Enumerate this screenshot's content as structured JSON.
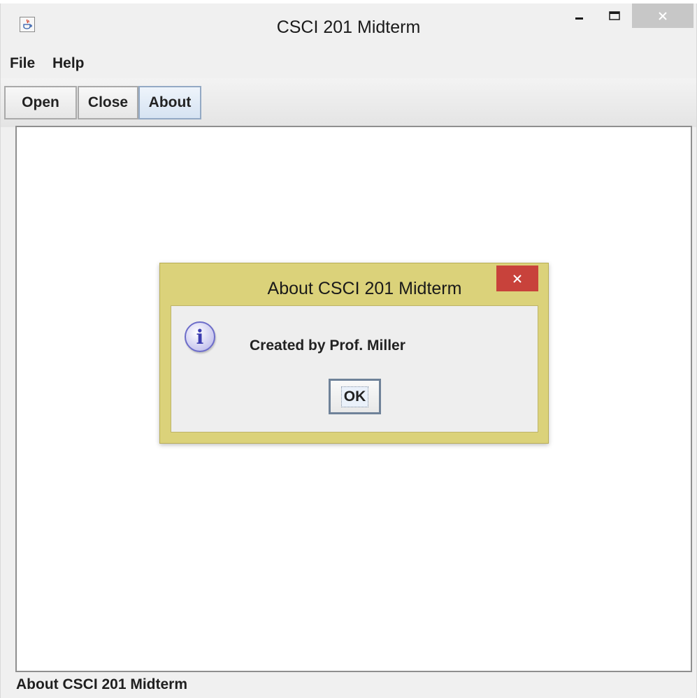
{
  "window": {
    "title": "CSCI 201 Midterm",
    "controls": {
      "minimize": "minimize-icon",
      "maximize": "maximize-icon",
      "close": "close-icon"
    }
  },
  "menubar": {
    "items": [
      {
        "label": "File"
      },
      {
        "label": "Help"
      }
    ]
  },
  "toolbar": {
    "buttons": [
      {
        "label": "Open"
      },
      {
        "label": "Close"
      },
      {
        "label": "About",
        "active": true
      }
    ]
  },
  "dialog": {
    "title": "About CSCI 201 Midterm",
    "message": "Created by Prof. Miller",
    "ok_label": "OK",
    "icon": "info-icon",
    "frame_color": "#dbd27a",
    "close_color": "#c8423b"
  },
  "status": {
    "text": "About CSCI 201 Midterm"
  }
}
